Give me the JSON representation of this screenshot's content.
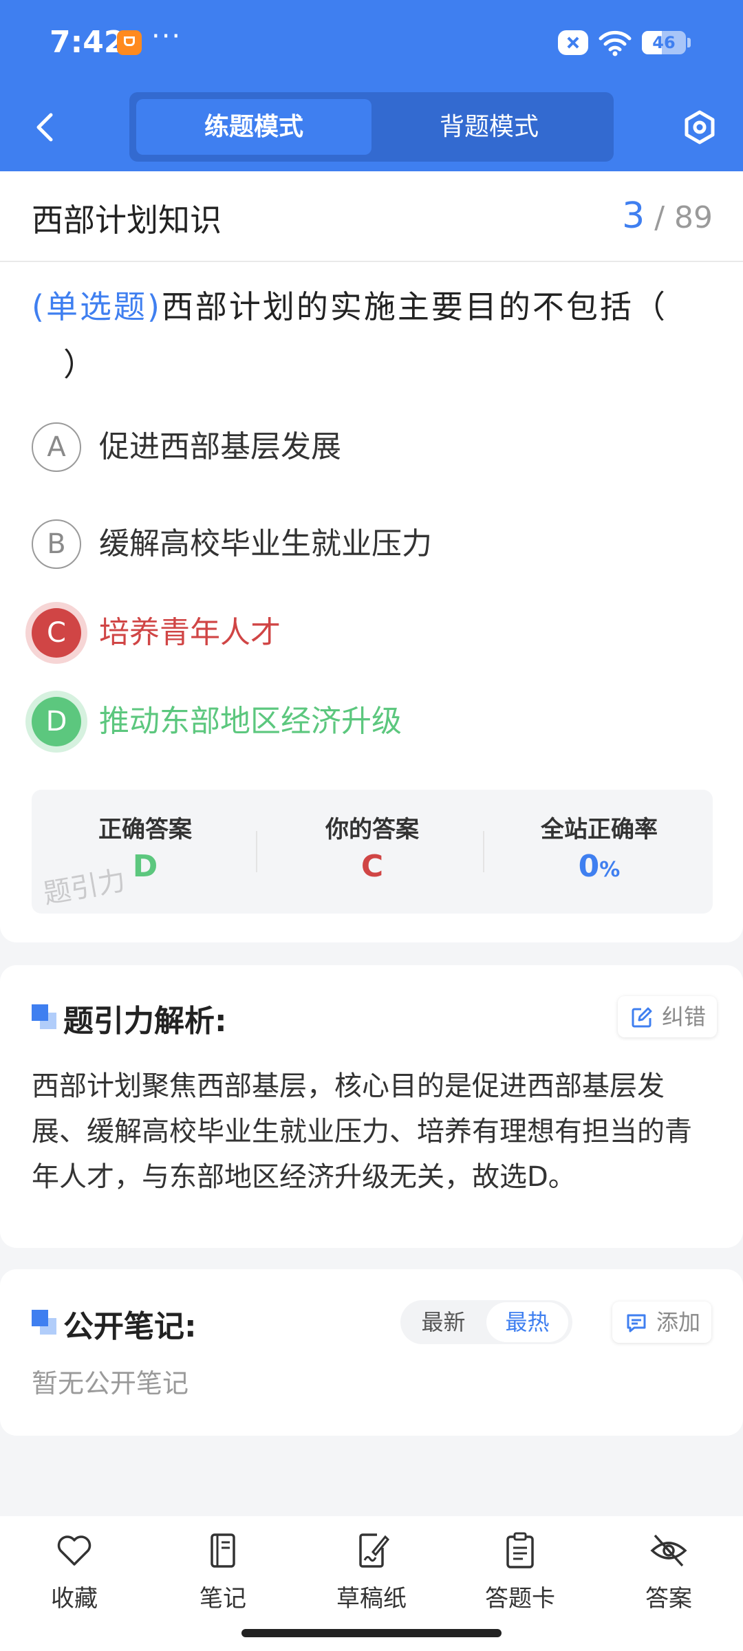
{
  "status_bar": {
    "time": "7:42",
    "dots": "···",
    "battery": "46",
    "battery_level": 0.46
  },
  "header": {
    "tabs": [
      {
        "label": "练题模式",
        "active": true
      },
      {
        "label": "背题模式",
        "active": false
      }
    ]
  },
  "question_card": {
    "section_title": "西部计划知识",
    "counter_current": "3",
    "counter_total": "/ 89",
    "question_type": "(单选题)",
    "question_line1": "西部计划的实施主要目的不包括（",
    "question_line2": "）",
    "options": [
      {
        "letter": "A",
        "text": "促进西部基层发展",
        "state": "normal"
      },
      {
        "letter": "B",
        "text": "缓解高校毕业生就业压力",
        "state": "normal"
      },
      {
        "letter": "C",
        "text": "培养青年人才",
        "state": "wrong"
      },
      {
        "letter": "D",
        "text": "推动东部地区经济升级",
        "state": "correct"
      }
    ],
    "stats": {
      "correct_label": "正确答案",
      "correct_value": "D",
      "yours_label": "你的答案",
      "yours_value": "C",
      "rate_label": "全站正确率",
      "rate_value": "0",
      "rate_unit": "%",
      "watermark": "题引力"
    }
  },
  "analysis": {
    "heading": "题引力解析:",
    "report_button": "纠错",
    "text": "西部计划聚焦西部基层，核心目的是促进西部基层发展、缓解高校毕业生就业压力、培养有理想有担当的青年人才，与东部地区经济升级无关，故选D。"
  },
  "notes": {
    "heading": "公开笔记:",
    "sort_latest": "最新",
    "sort_hot": "最热",
    "add_button": "添加",
    "empty": "暂无公开笔记"
  },
  "bottom_nav": [
    {
      "label": "收藏",
      "icon": "heart-icon"
    },
    {
      "label": "笔记",
      "icon": "notebook-icon"
    },
    {
      "label": "草稿纸",
      "icon": "draft-paper-icon"
    },
    {
      "label": "答题卡",
      "icon": "answer-sheet-icon"
    },
    {
      "label": "答案",
      "icon": "eye-off-icon"
    }
  ],
  "colors": {
    "primary": "#3f7ff0",
    "wrong": "#d04545",
    "correct": "#5cc77e"
  }
}
